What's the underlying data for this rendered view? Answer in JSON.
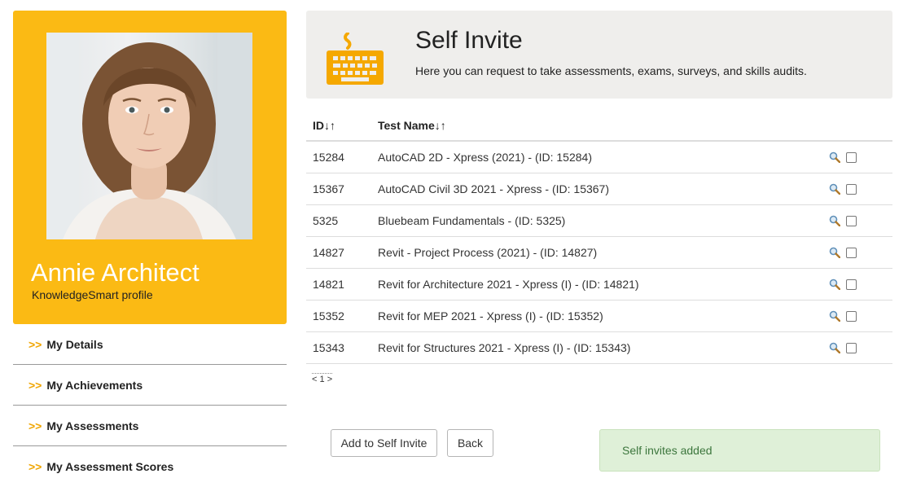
{
  "profile": {
    "name": "Annie Architect",
    "subtitle": "KnowledgeSmart profile",
    "card_color": "#fbba14"
  },
  "side_menu": [
    {
      "arrow": ">>",
      "label": "My Details"
    },
    {
      "arrow": ">>",
      "label": "My Achievements"
    },
    {
      "arrow": ">>",
      "label": "My Assessments"
    },
    {
      "arrow": ">>",
      "label": "My Assessment Scores"
    }
  ],
  "header": {
    "icon": "keyboard-icon",
    "title": "Self Invite",
    "description": "Here you can request to take assessments, exams, surveys, and skills audits."
  },
  "table": {
    "columns": [
      "ID↓↑",
      "Test Name↓↑"
    ],
    "rows": [
      {
        "id": "15284",
        "name": "AutoCAD 2D - Xpress (2021) - (ID: 15284)",
        "checked": false
      },
      {
        "id": "15367",
        "name": "AutoCAD Civil 3D 2021 - Xpress - (ID: 15367)",
        "checked": false
      },
      {
        "id": "5325",
        "name": "Bluebeam Fundamentals - (ID: 5325)",
        "checked": false
      },
      {
        "id": "14827",
        "name": "Revit - Project Process (2021) - (ID: 14827)",
        "checked": false
      },
      {
        "id": "14821",
        "name": "Revit for Architecture 2021 - Xpress (I) - (ID: 14821)",
        "checked": false
      },
      {
        "id": "15352",
        "name": "Revit for MEP 2021 - Xpress (I) - (ID: 15352)",
        "checked": false
      },
      {
        "id": "15343",
        "name": "Revit for Structures 2021 - Xpress (I) - (ID: 15343)",
        "checked": false
      }
    ]
  },
  "pager": {
    "prev": "<",
    "page": "1",
    "next": ">"
  },
  "buttons": {
    "add": "Add to Self Invite",
    "back": "Back"
  },
  "alert": {
    "text": "Self invites added",
    "color": "#3c763d",
    "background": "#dff0d8"
  }
}
